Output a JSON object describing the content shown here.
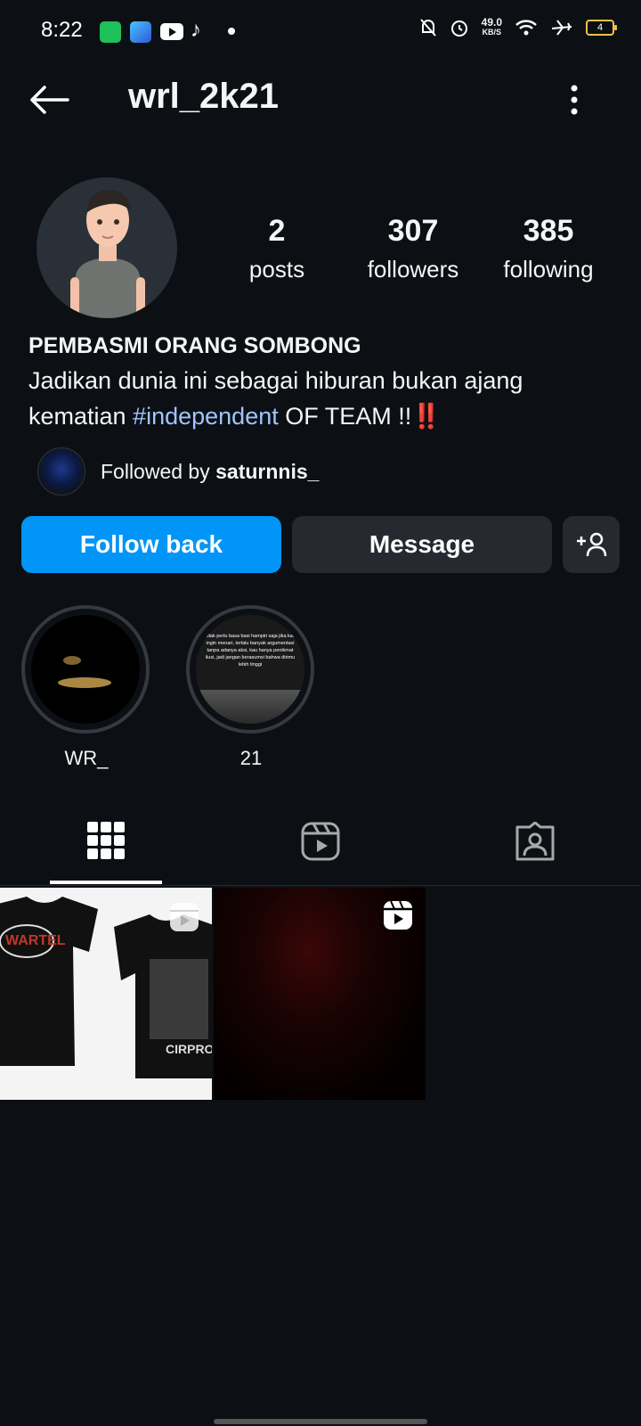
{
  "status_bar": {
    "time": "8:22",
    "net_speed_value": "49.0",
    "net_speed_unit": "KB/S",
    "battery": "4"
  },
  "header": {
    "username": "wrl_2k21",
    "back_icon": "arrow-left-icon",
    "menu_icon": "more-vertical-icon"
  },
  "profile": {
    "stats": [
      {
        "value": "2",
        "label": "posts"
      },
      {
        "value": "307",
        "label": "followers"
      },
      {
        "value": "385",
        "label": "following"
      }
    ],
    "bio": {
      "name": "PEMBASMI ORANG SOMBONG",
      "text_line1": "Jadikan dunia ini sebagai hiburan bukan ajang",
      "text_line2_prefix": "kematian ",
      "hashtag": "#independent",
      "text_line2_suffix": " OF TEAM !!",
      "emoji": "‼️"
    },
    "followed_by": {
      "prefix": "Followed by ",
      "user": "saturnnis_"
    }
  },
  "actions": {
    "follow_back": "Follow back",
    "message": "Message",
    "add_icon": "add-person-icon"
  },
  "highlights": [
    {
      "label": "WR_"
    },
    {
      "label": "21",
      "quote": "tidak perlu basa basi hampiri saja jika kau ingin menari, terlalu banyak argumentasi tanpa adanya aksi, kau hanya penikmat ilusi, jadi jangan berasumsi bahwa dirimu lebih tinggi"
    }
  ],
  "tabs": [
    {
      "icon": "grid-icon",
      "active": true
    },
    {
      "icon": "reels-icon",
      "active": false
    },
    {
      "icon": "tagged-icon",
      "active": false
    }
  ],
  "posts": [
    {
      "type": "reel",
      "shirt_text_1": "WARTEL",
      "shirt_text_2": "CIRPROE"
    },
    {
      "type": "reel"
    }
  ],
  "colors": {
    "background": "#0c1014",
    "primary_button": "#0095f6",
    "secondary_button": "#262a30",
    "hashtag": "#a0c4ff"
  }
}
